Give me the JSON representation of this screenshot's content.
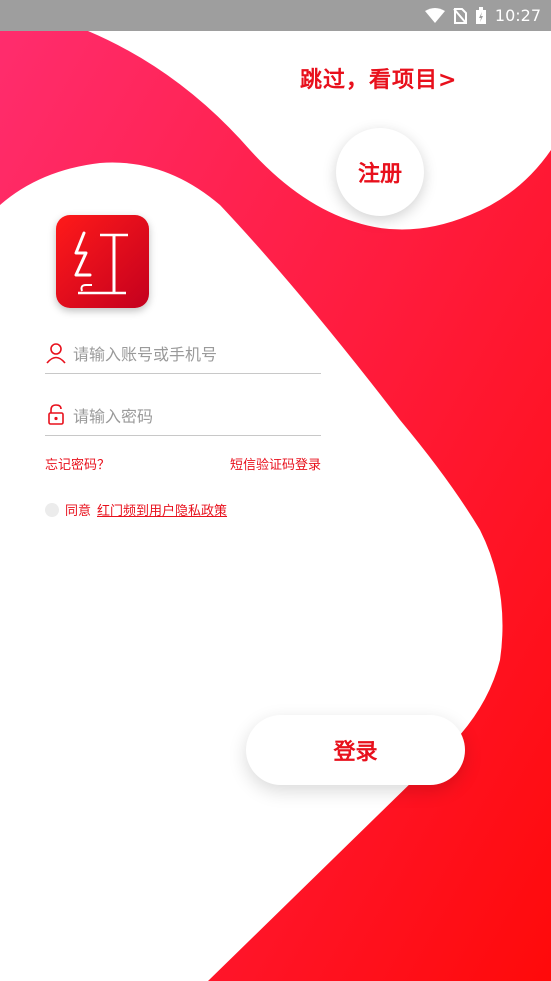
{
  "status_bar": {
    "time": "10:27",
    "icons": [
      "wifi-icon",
      "no-sim-icon",
      "battery-charging-icon"
    ]
  },
  "header": {
    "skip_label": "跳过，看项目>",
    "register_label": "注册"
  },
  "logo": {
    "name": "app-logo",
    "glyph_color": "#ffffff"
  },
  "form": {
    "account_placeholder": "请输入账号或手机号",
    "password_placeholder": "请输入密码",
    "forgot_password": "忘记密码？",
    "sms_login": "短信验证码登录",
    "agree_prefix": "同意",
    "policy_link": "红门频到用户隐私政策",
    "agree_checked": false
  },
  "actions": {
    "login_label": "登录"
  },
  "colors": {
    "accent": "#e8101c",
    "gradient_start": "#ff2d6f",
    "gradient_end": "#ff0a0a"
  }
}
